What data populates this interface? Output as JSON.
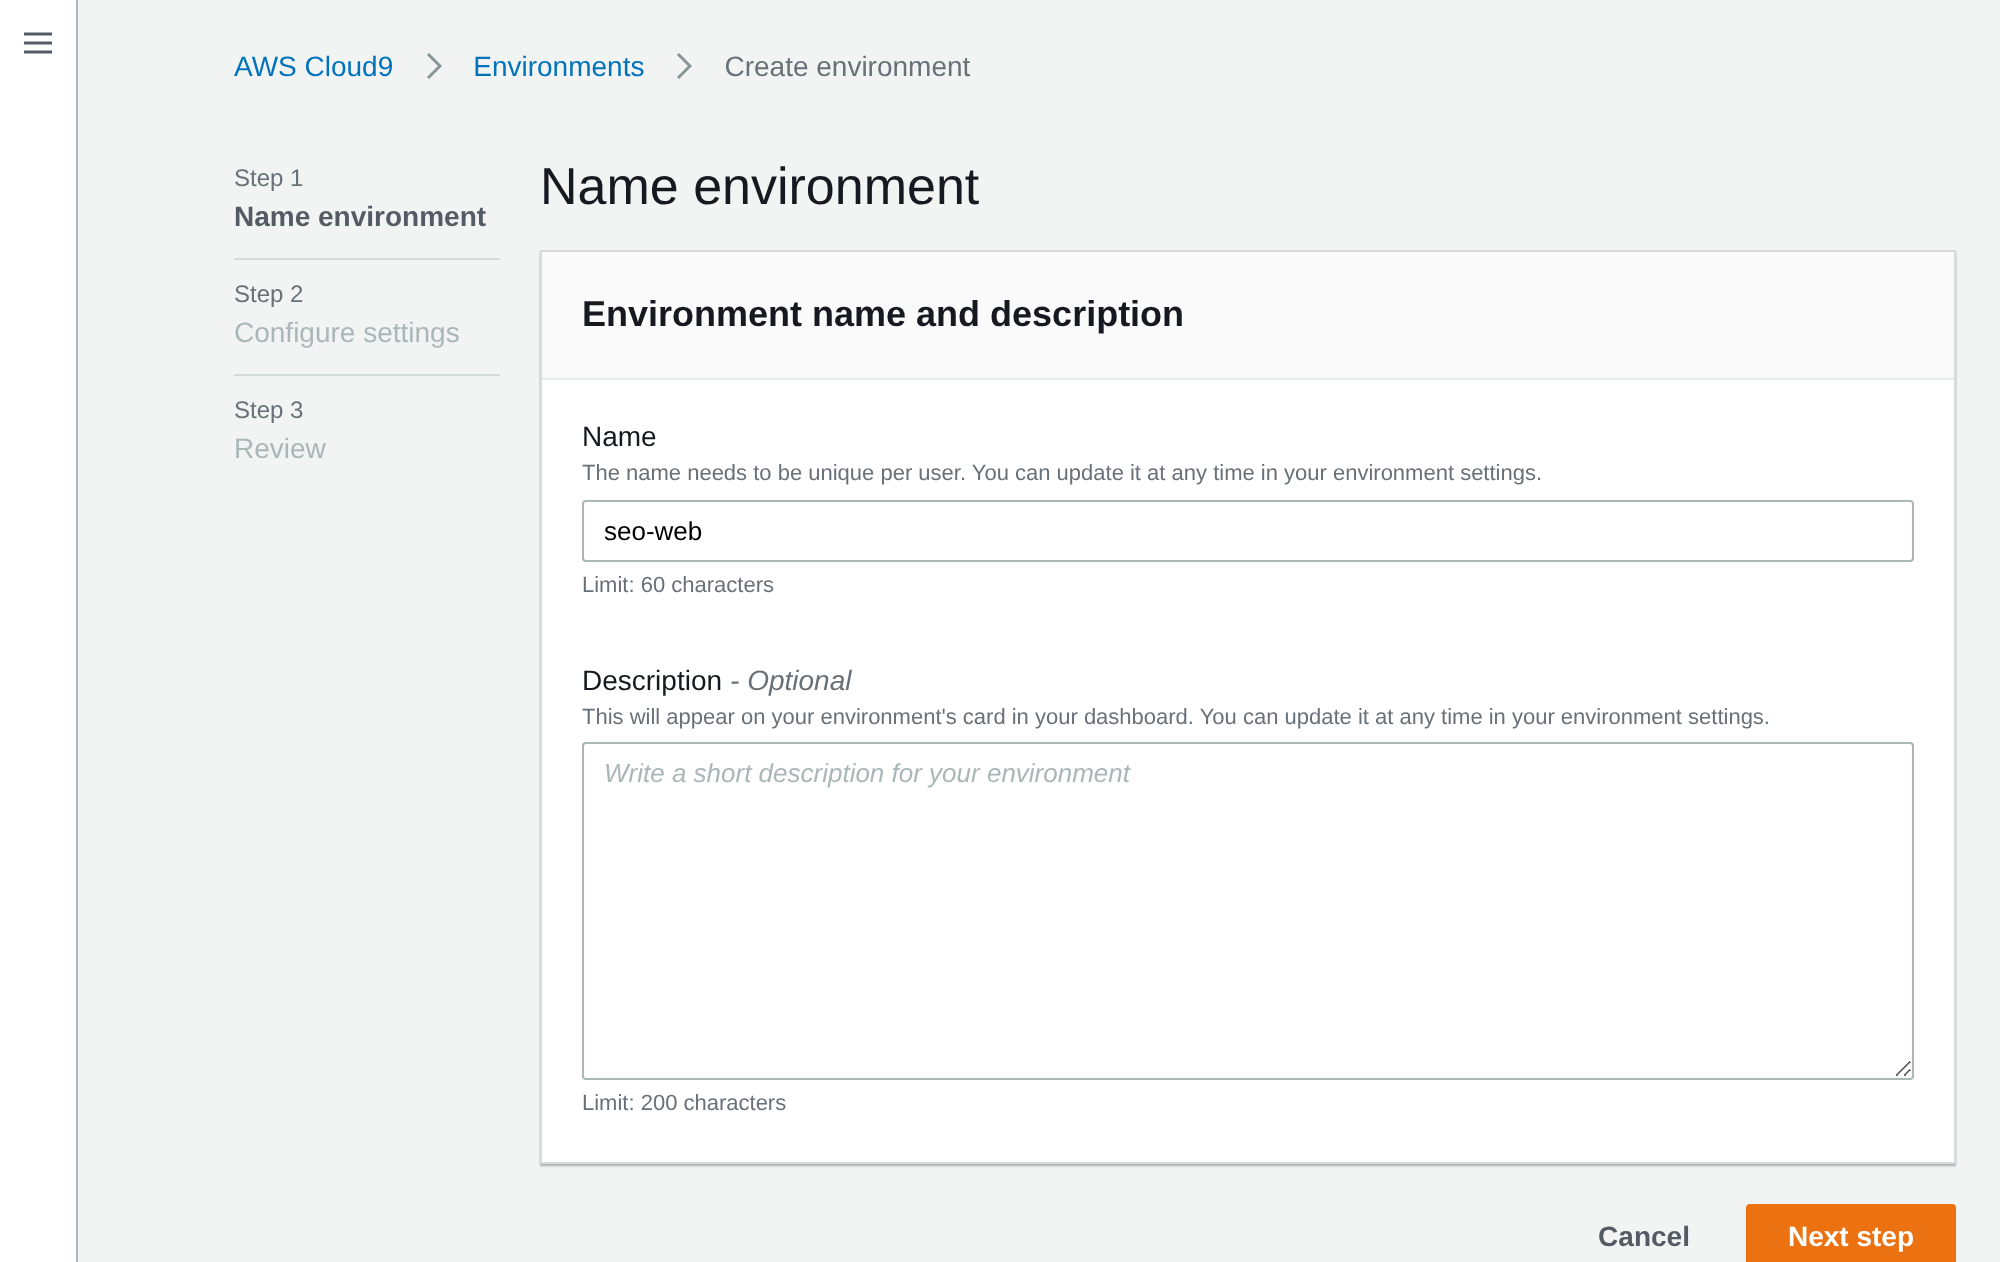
{
  "breadcrumbs": [
    {
      "label": "AWS Cloud9",
      "kind": "link"
    },
    {
      "label": "Environments",
      "kind": "link"
    },
    {
      "label": "Create environment",
      "kind": "current"
    }
  ],
  "steps": [
    {
      "number": "Step 1",
      "label": "Name environment",
      "selected": true
    },
    {
      "number": "Step 2",
      "label": "Configure settings",
      "selected": false
    },
    {
      "number": "Step 3",
      "label": "Review",
      "selected": false
    }
  ],
  "page_title": "Name environment",
  "card": {
    "title": "Environment name and description",
    "fields": [
      {
        "kind": "input",
        "label": "Name",
        "hint": "The name needs to be unique per user. You can update it at any time in your environment settings.",
        "value": "seo-web",
        "limit": "Limit: 60 characters"
      },
      {
        "kind": "textarea",
        "label": "Description",
        "optional": "- Optional",
        "hint": "This will appear on your environment's card in your dashboard. You can update it at any time in your environment settings.",
        "placeholder": "Write a short description for your environment",
        "limit": "Limit: 200 characters"
      }
    ]
  },
  "buttons": [
    {
      "label": "Cancel",
      "kind": "link"
    },
    {
      "label": "Next step",
      "kind": "primary"
    }
  ]
}
